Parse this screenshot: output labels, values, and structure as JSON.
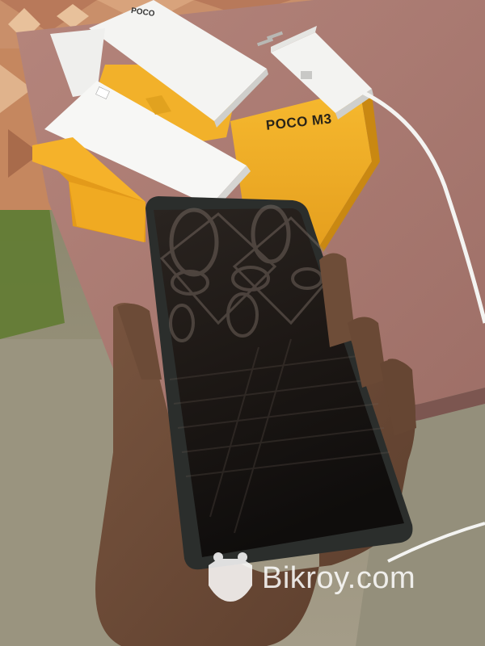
{
  "photo": {
    "box_brand": "POCO M3",
    "card_brand": "POCO",
    "watermark": "Bikroy.com",
    "colors": {
      "box_yellow": "#f2b12a",
      "table_top": "#b07d74",
      "phone_body": "#2b2e2c",
      "skin": "#6b4a35",
      "charger_white": "#f3f3f1"
    },
    "objects": [
      "wall-tiles",
      "grass",
      "pink-table",
      "yellow-box",
      "white-manuals",
      "charger",
      "usb-cable",
      "hand",
      "smartphone",
      "watermark-logo"
    ]
  }
}
